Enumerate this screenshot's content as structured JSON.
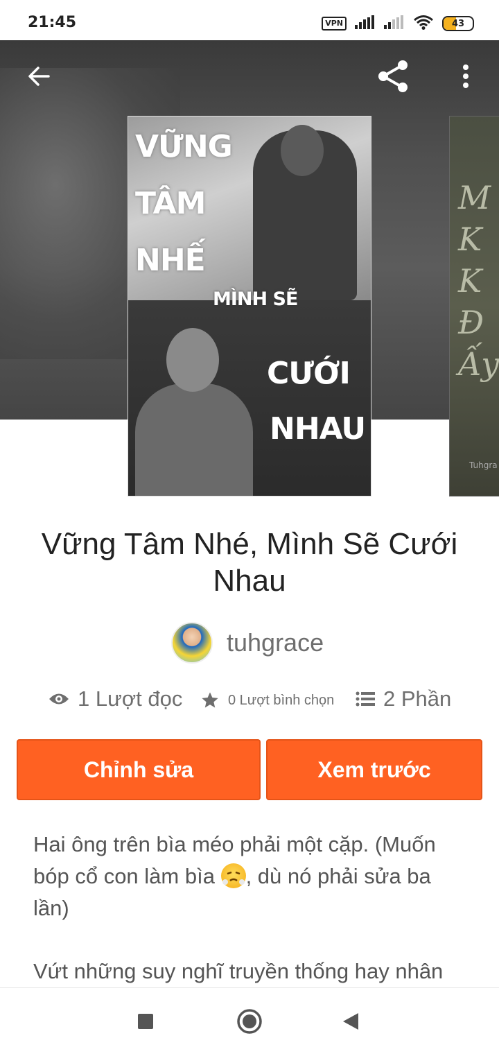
{
  "status_bar": {
    "time": "21:45",
    "vpn": "VPN",
    "battery": "43",
    "battery_level_percent": 43
  },
  "toolbar": {
    "back_icon": "arrow-left-icon",
    "share_icon": "share-icon",
    "more_icon": "more-vertical-icon"
  },
  "cover": {
    "line1": "VỮNG",
    "line2": "TÂM",
    "line3": "NHẾ",
    "line4": "MÌNH SẼ",
    "line5": "CƯỚI",
    "line6": "NHAU",
    "next_cover_letters": [
      "M",
      "K",
      "K",
      "Đ",
      "Ấy"
    ],
    "next_cover_footer": "Tuhgra"
  },
  "story": {
    "title": "Vững Tâm Nhé, Mình Sẽ Cưới Nhau",
    "author": "tuhgrace"
  },
  "stats": {
    "reads": "1 Lượt đọc",
    "votes": "0 Lượt bình chọn",
    "parts": "2 Phần"
  },
  "actions": {
    "edit": "Chỉnh sửa",
    "preview": "Xem trước"
  },
  "description": {
    "part1": "Hai ông trên bìa méo phải một cặp. (Muốn bóp cổ con làm bìa ",
    "part2": ", dù nó phải sửa ba lần)",
    "emoji": "😤",
    "paragraph2": "Vứt những suy nghĩ truyền thống hay nhân"
  },
  "colors": {
    "accent": "#ff6122",
    "text_muted": "#6e6e6e"
  }
}
